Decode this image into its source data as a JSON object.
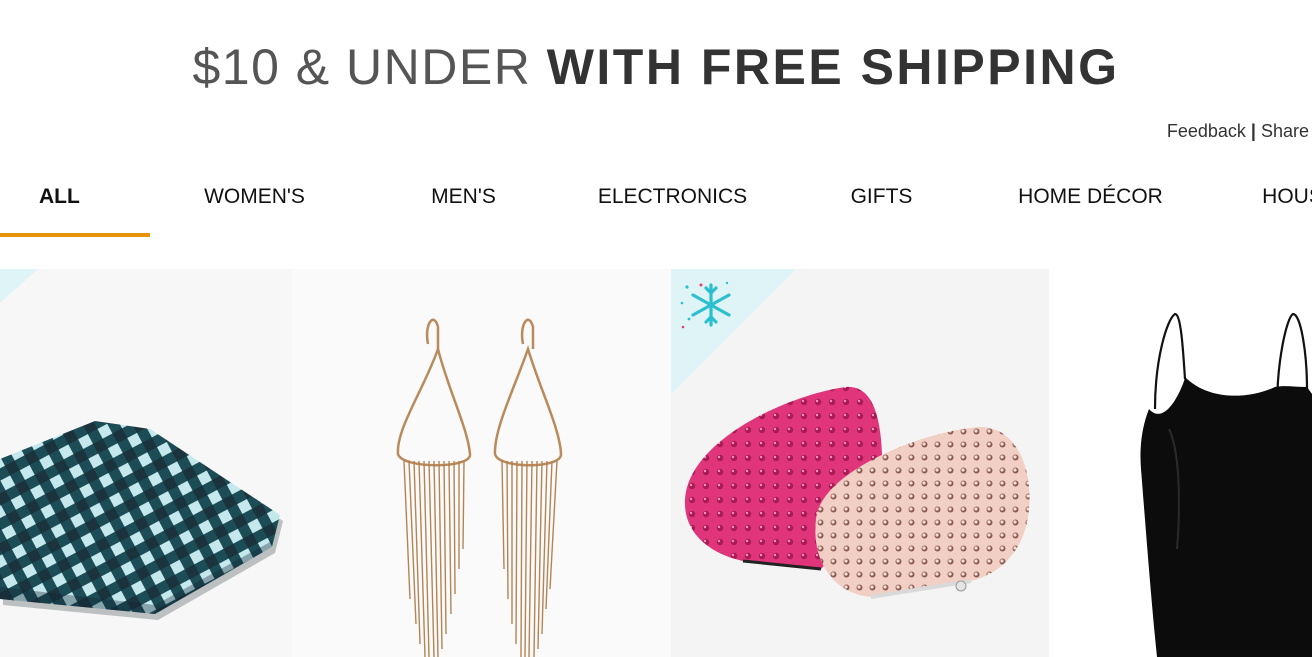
{
  "header": {
    "title_light": "$10 & UNDER",
    "title_bold": "WITH FREE SHIPPING"
  },
  "links": {
    "feedback": "Feedback",
    "separator": "|",
    "share": "Share"
  },
  "tabs": [
    {
      "label": "ALL",
      "selected": true
    },
    {
      "label": "WOMEN'S"
    },
    {
      "label": "MEN'S"
    },
    {
      "label": "ELECTRONICS"
    },
    {
      "label": "GIFTS"
    },
    {
      "label": "HOME DÉCOR"
    },
    {
      "label": "HOUSE"
    }
  ],
  "colors": {
    "accent": "#e8930c",
    "banner_text": "#555555",
    "banner_bold": "#333333",
    "holiday_corner": "#dff4f7",
    "snowflake": "#2bbfd0"
  },
  "products": [
    {
      "image": "teal-black-plaid-pocket-square"
    },
    {
      "image": "gold-fringe-teardrop-earrings"
    },
    {
      "image": "pink-and-blush-sequin-coin-purses",
      "badge": "snowflake-icon"
    },
    {
      "image": "black-spaghetti-strap-cami-dress"
    }
  ]
}
